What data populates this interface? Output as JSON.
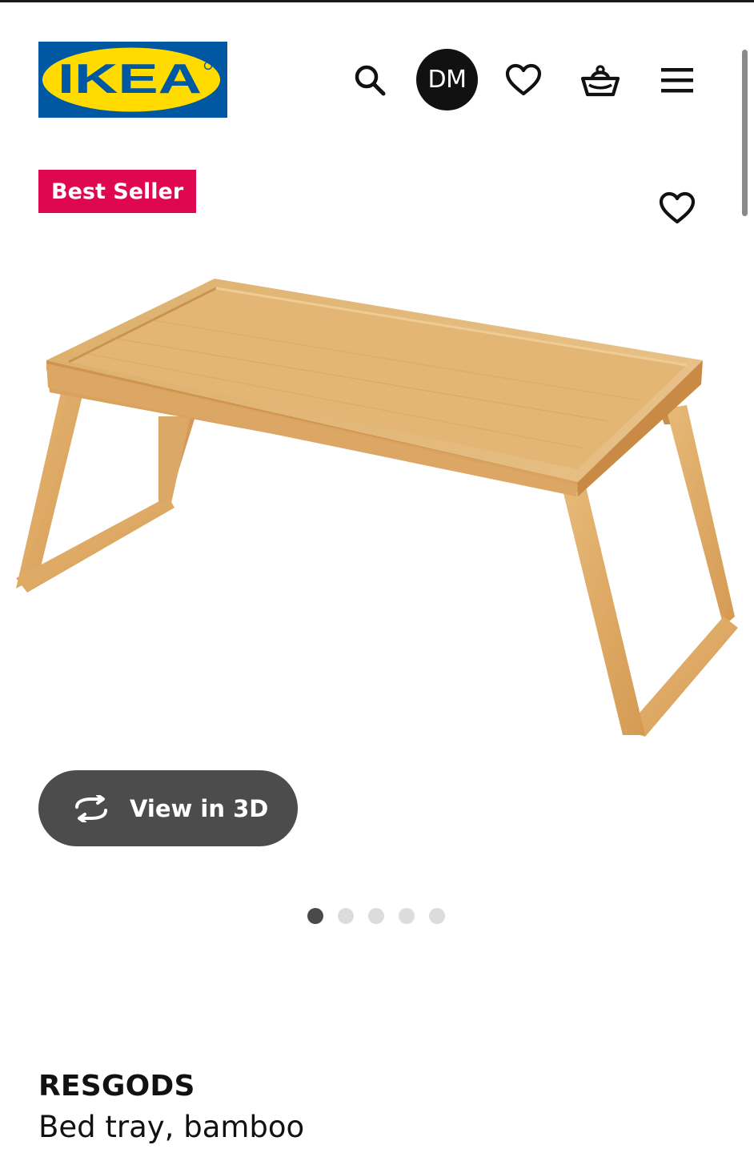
{
  "brand": {
    "logo_text": "IKEA",
    "colors": {
      "blue": "#0058a3",
      "yellow": "#ffdb00"
    }
  },
  "header": {
    "icons": [
      "search-icon",
      "heart-icon",
      "basket-icon",
      "menu-icon"
    ],
    "avatar_initials": "DM"
  },
  "product": {
    "badge": "Best Seller",
    "badge_color": "#e00751",
    "image_icon": "bed-tray-image",
    "view_3d_label": "View in 3D",
    "carousel": {
      "total": 5,
      "active_index": 0
    },
    "name": "RESGODS",
    "description": "Bed tray, bamboo"
  }
}
